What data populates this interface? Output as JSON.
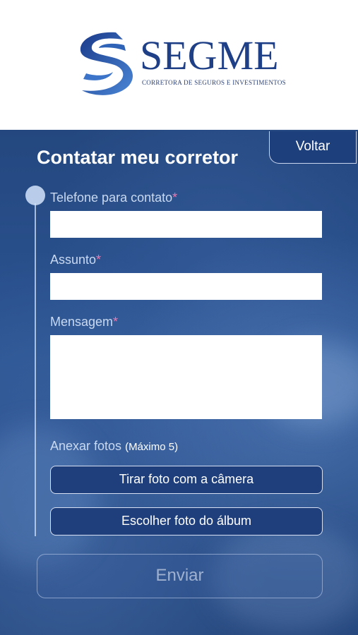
{
  "brand": {
    "name": "SEGME",
    "tagline": "CORRETORA DE SEGUROS E INVESTIMENTOS"
  },
  "page": {
    "title": "Contatar meu corretor",
    "back_label": "Voltar"
  },
  "form": {
    "phone_label": "Telefone para contato",
    "subject_label": "Assunto",
    "message_label": "Mensagem",
    "required_mark": "*",
    "phone_value": "",
    "subject_value": "",
    "message_value": "",
    "attach_label": "Anexar fotos",
    "attach_note": "(Máximo 5)",
    "camera_button": "Tirar foto com a câmera",
    "album_button": "Escolher foto do álbum",
    "send_button": "Enviar"
  },
  "colors": {
    "brand_blue": "#1f3f86",
    "panel_blue": "#2c5593",
    "required": "#e87ab0"
  }
}
